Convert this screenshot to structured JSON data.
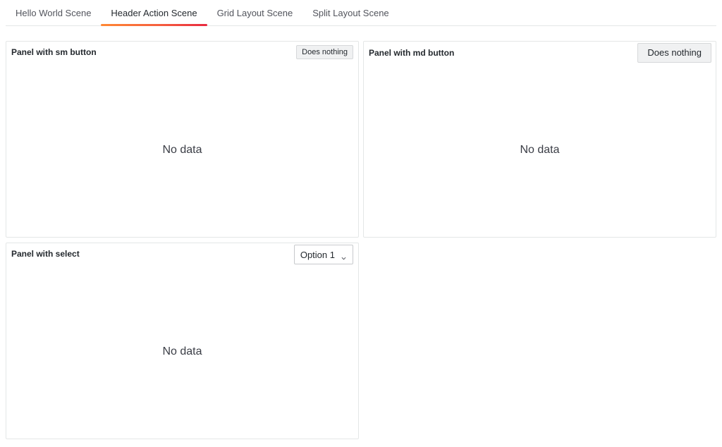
{
  "tabs": [
    {
      "label": "Hello World Scene",
      "active": false
    },
    {
      "label": "Header Action Scene",
      "active": true
    },
    {
      "label": "Grid Layout Scene",
      "active": false
    },
    {
      "label": "Split Layout Scene",
      "active": false
    }
  ],
  "panels": {
    "sm": {
      "title": "Panel with sm button",
      "button_label": "Does nothing",
      "empty_text": "No data"
    },
    "md": {
      "title": "Panel with md button",
      "button_label": "Does nothing",
      "empty_text": "No data"
    },
    "select": {
      "title": "Panel with select",
      "select_value": "Option 1",
      "empty_text": "No data"
    }
  },
  "colors": {
    "accent_gradient": [
      "#ff8833",
      "#e8293f"
    ],
    "border": "#e4e7e7"
  },
  "icons": {
    "select_caret": "chevron-down-icon"
  }
}
